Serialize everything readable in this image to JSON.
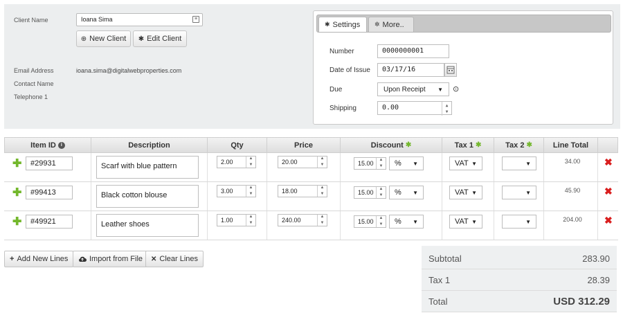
{
  "client": {
    "name_label": "Client Name",
    "name_value": "Ioana Sima",
    "new_client_label": "New Client",
    "edit_client_label": "Edit Client",
    "email_label": "Email Address",
    "email_value": "ioana.sima@digitalwebproperties.com",
    "contact_label": "Contact Name",
    "telephone_label": "Telephone 1"
  },
  "settings": {
    "tabs": [
      {
        "label": "Settings",
        "icon": "gear-icon"
      },
      {
        "label": "More..",
        "icon": "gears-icon"
      }
    ],
    "number_label": "Number",
    "number_value": "0000000001",
    "date_label": "Date of Issue",
    "date_value": "03/17/16",
    "due_label": "Due",
    "due_value": "Upon Receipt",
    "shipping_label": "Shipping",
    "shipping_value": "0.00"
  },
  "table": {
    "headers": {
      "item_id": "Item ID",
      "description": "Description",
      "qty": "Qty",
      "price": "Price",
      "discount": "Discount",
      "tax1": "Tax 1",
      "tax2": "Tax 2",
      "line_total": "Line Total"
    },
    "rows": [
      {
        "item_id": "#29931",
        "description": "Scarf with blue pattern",
        "qty": "2.00",
        "price": "20.00",
        "discount": "15.00",
        "discount_type": "%",
        "tax1": "VAT",
        "tax2": "",
        "line_total": "34.00"
      },
      {
        "item_id": "#99413",
        "description": "Black cotton blouse",
        "qty": "3.00",
        "price": "18.00",
        "discount": "15.00",
        "discount_type": "%",
        "tax1": "VAT",
        "tax2": "",
        "line_total": "45.90"
      },
      {
        "item_id": "#49921",
        "description": "Leather shoes",
        "qty": "1.00",
        "price": "240.00",
        "discount": "15.00",
        "discount_type": "%",
        "tax1": "VAT",
        "tax2": "",
        "line_total": "204.00"
      }
    ]
  },
  "actions": {
    "add_lines": "Add New Lines",
    "import": "Import from File",
    "clear": "Clear Lines"
  },
  "totals": {
    "subtotal_label": "Subtotal",
    "subtotal_value": "283.90",
    "tax1_label": "Tax 1",
    "tax1_value": "28.39",
    "total_label": "Total",
    "total_value": "USD 312.29"
  },
  "colors": {
    "accent_green": "#73b72c",
    "delete_red": "#d91e1e",
    "panel_bg": "#eceeef"
  }
}
